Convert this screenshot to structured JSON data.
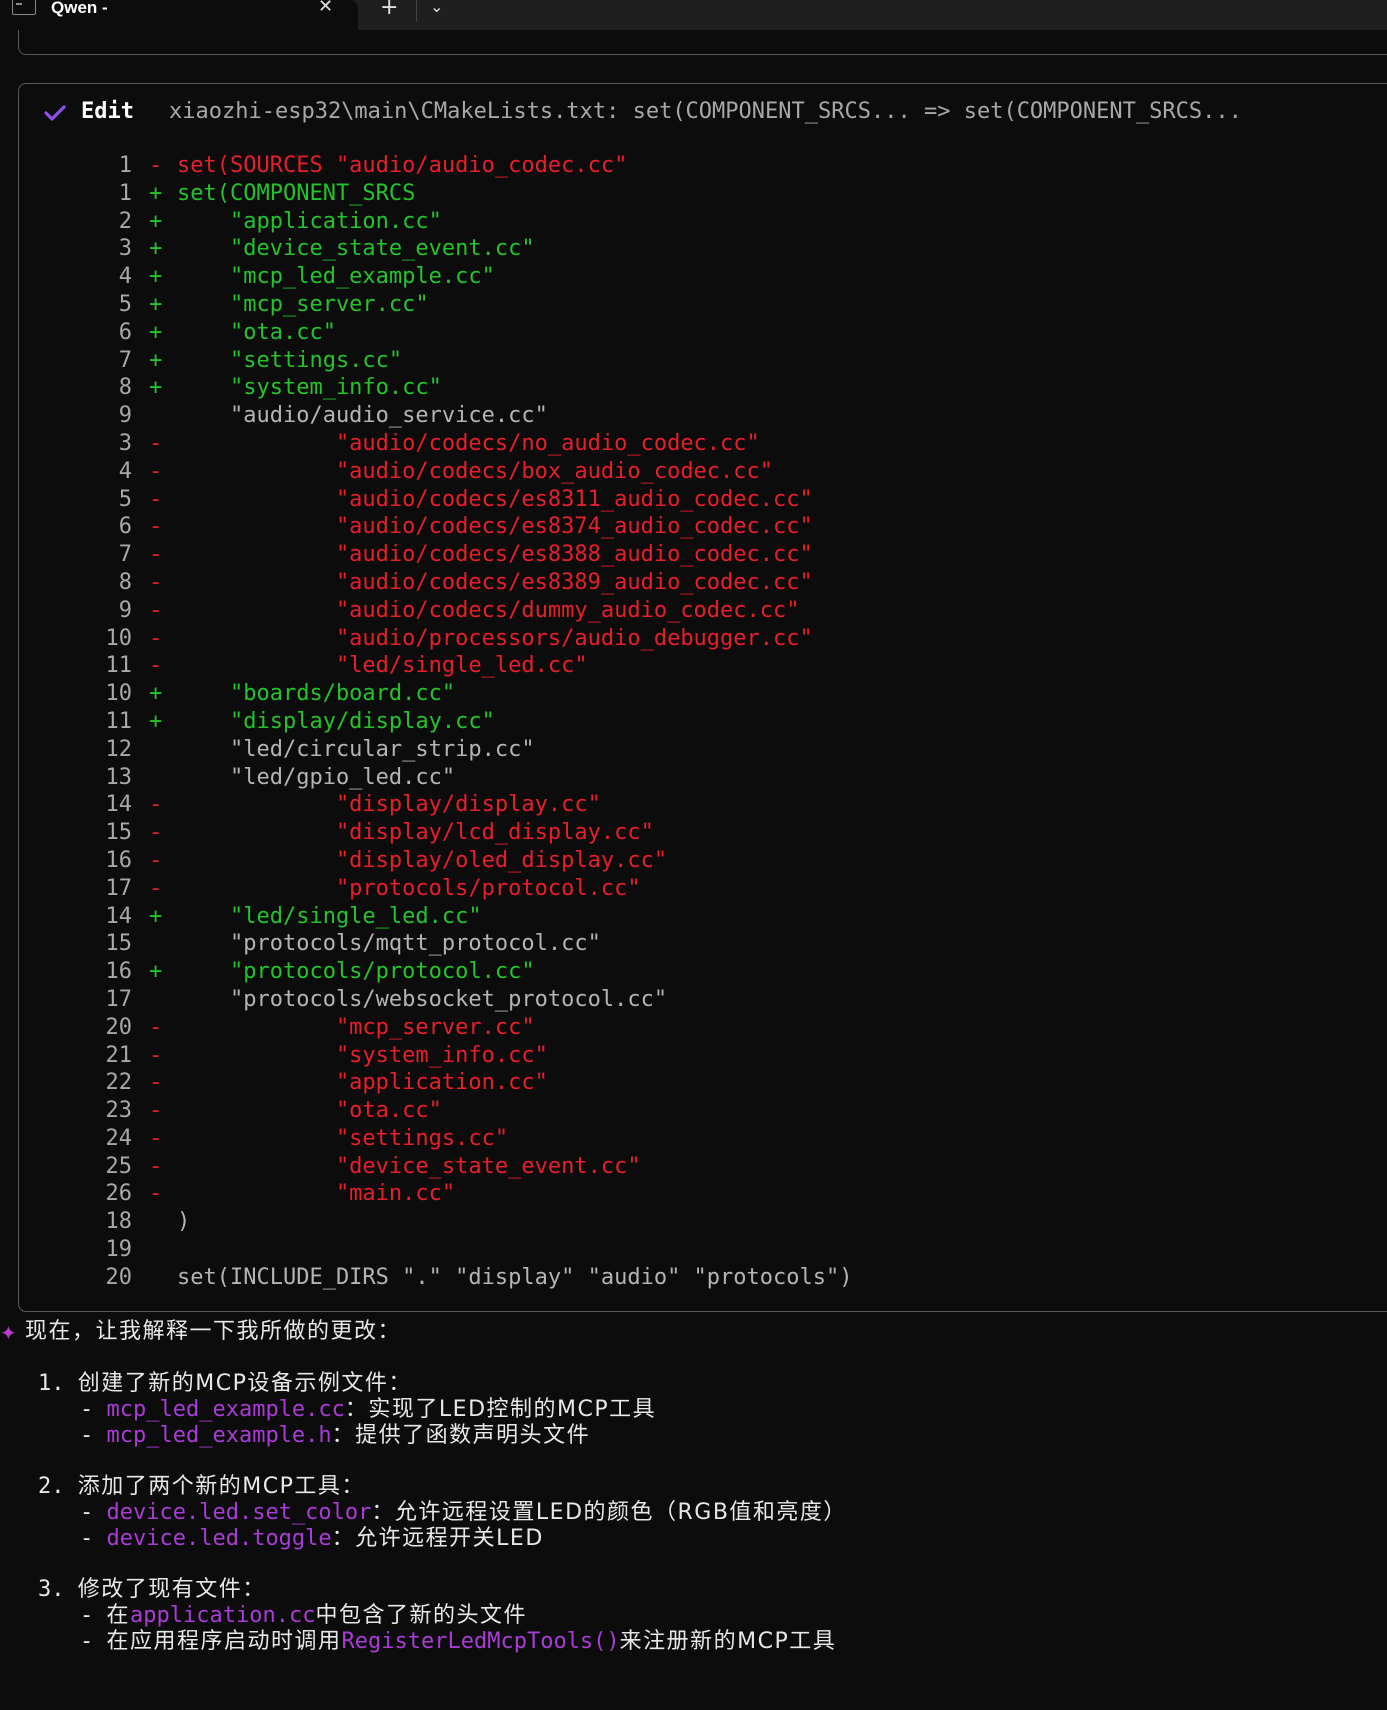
{
  "window": {
    "tab_title": "Qwen -",
    "close_glyph": "✕",
    "new_tab_glyph": "+",
    "dropdown_glyph": "⌄"
  },
  "colors": {
    "deleted": "#e81e2a",
    "added": "#23c42b",
    "context": "#b4b4b4",
    "code_ref": "#a93bd6",
    "check": "#8a52e8"
  },
  "edit": {
    "icon": "check-icon",
    "label": "Edit",
    "description": "xiaozhi-esp32\\main\\CMakeLists.txt: set(COMPONENT_SRCS... => set(COMPONENT_SRCS...",
    "diff_lines": [
      {
        "num": "1",
        "type": "del",
        "marker": "-",
        "code": "set(SOURCES \"audio/audio_codec.cc\""
      },
      {
        "num": "1",
        "type": "add",
        "marker": "+",
        "code": "set(COMPONENT_SRCS"
      },
      {
        "num": "2",
        "type": "add",
        "marker": "+",
        "code": "    \"application.cc\""
      },
      {
        "num": "3",
        "type": "add",
        "marker": "+",
        "code": "    \"device_state_event.cc\""
      },
      {
        "num": "4",
        "type": "add",
        "marker": "+",
        "code": "    \"mcp_led_example.cc\""
      },
      {
        "num": "5",
        "type": "add",
        "marker": "+",
        "code": "    \"mcp_server.cc\""
      },
      {
        "num": "6",
        "type": "add",
        "marker": "+",
        "code": "    \"ota.cc\""
      },
      {
        "num": "7",
        "type": "add",
        "marker": "+",
        "code": "    \"settings.cc\""
      },
      {
        "num": "8",
        "type": "add",
        "marker": "+",
        "code": "    \"system_info.cc\""
      },
      {
        "num": "9",
        "type": "ctx",
        "marker": "",
        "code": "    \"audio/audio_service.cc\""
      },
      {
        "num": "3",
        "type": "del",
        "marker": "-",
        "code": "            \"audio/codecs/no_audio_codec.cc\""
      },
      {
        "num": "4",
        "type": "del",
        "marker": "-",
        "code": "            \"audio/codecs/box_audio_codec.cc\""
      },
      {
        "num": "5",
        "type": "del",
        "marker": "-",
        "code": "            \"audio/codecs/es8311_audio_codec.cc\""
      },
      {
        "num": "6",
        "type": "del",
        "marker": "-",
        "code": "            \"audio/codecs/es8374_audio_codec.cc\""
      },
      {
        "num": "7",
        "type": "del",
        "marker": "-",
        "code": "            \"audio/codecs/es8388_audio_codec.cc\""
      },
      {
        "num": "8",
        "type": "del",
        "marker": "-",
        "code": "            \"audio/codecs/es8389_audio_codec.cc\""
      },
      {
        "num": "9",
        "type": "del",
        "marker": "-",
        "code": "            \"audio/codecs/dummy_audio_codec.cc\""
      },
      {
        "num": "10",
        "type": "del",
        "marker": "-",
        "code": "            \"audio/processors/audio_debugger.cc\""
      },
      {
        "num": "11",
        "type": "del",
        "marker": "-",
        "code": "            \"led/single_led.cc\""
      },
      {
        "num": "10",
        "type": "add",
        "marker": "+",
        "code": "    \"boards/board.cc\""
      },
      {
        "num": "11",
        "type": "add",
        "marker": "+",
        "code": "    \"display/display.cc\""
      },
      {
        "num": "12",
        "type": "ctx",
        "marker": "",
        "code": "    \"led/circular_strip.cc\""
      },
      {
        "num": "13",
        "type": "ctx",
        "marker": "",
        "code": "    \"led/gpio_led.cc\""
      },
      {
        "num": "14",
        "type": "del",
        "marker": "-",
        "code": "            \"display/display.cc\""
      },
      {
        "num": "15",
        "type": "del",
        "marker": "-",
        "code": "            \"display/lcd_display.cc\""
      },
      {
        "num": "16",
        "type": "del",
        "marker": "-",
        "code": "            \"display/oled_display.cc\""
      },
      {
        "num": "17",
        "type": "del",
        "marker": "-",
        "code": "            \"protocols/protocol.cc\""
      },
      {
        "num": "14",
        "type": "add",
        "marker": "+",
        "code": "    \"led/single_led.cc\""
      },
      {
        "num": "15",
        "type": "ctx",
        "marker": "",
        "code": "    \"protocols/mqtt_protocol.cc\""
      },
      {
        "num": "16",
        "type": "add",
        "marker": "+",
        "code": "    \"protocols/protocol.cc\""
      },
      {
        "num": "17",
        "type": "ctx",
        "marker": "",
        "code": "    \"protocols/websocket_protocol.cc\""
      },
      {
        "num": "20",
        "type": "del",
        "marker": "-",
        "code": "            \"mcp_server.cc\""
      },
      {
        "num": "21",
        "type": "del",
        "marker": "-",
        "code": "            \"system_info.cc\""
      },
      {
        "num": "22",
        "type": "del",
        "marker": "-",
        "code": "            \"application.cc\""
      },
      {
        "num": "23",
        "type": "del",
        "marker": "-",
        "code": "            \"ota.cc\""
      },
      {
        "num": "24",
        "type": "del",
        "marker": "-",
        "code": "            \"settings.cc\""
      },
      {
        "num": "25",
        "type": "del",
        "marker": "-",
        "code": "            \"device_state_event.cc\""
      },
      {
        "num": "26",
        "type": "del",
        "marker": "-",
        "code": "            \"main.cc\""
      },
      {
        "num": "18",
        "type": "ctx",
        "marker": "",
        "code": ")"
      },
      {
        "num": "19",
        "type": "ctx",
        "marker": "",
        "code": ""
      },
      {
        "num": "20",
        "type": "ctx",
        "marker": "",
        "code": "set(INCLUDE_DIRS \".\" \"display\" \"audio\" \"protocols\")"
      }
    ]
  },
  "explanation": {
    "icon": "sparkle-icon",
    "intro": "现在，让我解释一下我所做的更改：",
    "sections": [
      {
        "number": "1.",
        "title": "创建了新的MCP设备示例文件：",
        "items": [
          {
            "parts": [
              {
                "text": "mcp_led_example.cc",
                "code": true
              },
              {
                "text": "：实现了LED控制的MCP工具",
                "code": false
              }
            ]
          },
          {
            "parts": [
              {
                "text": "mcp_led_example.h",
                "code": true
              },
              {
                "text": "：提供了函数声明头文件",
                "code": false
              }
            ]
          }
        ]
      },
      {
        "number": "2.",
        "title": "添加了两个新的MCP工具：",
        "items": [
          {
            "parts": [
              {
                "text": "device.led.set_color",
                "code": true
              },
              {
                "text": "：允许远程设置LED的颜色（RGB值和亮度）",
                "code": false
              }
            ]
          },
          {
            "parts": [
              {
                "text": "device.led.toggle",
                "code": true
              },
              {
                "text": "：允许远程开关LED",
                "code": false
              }
            ]
          }
        ]
      },
      {
        "number": "3.",
        "title": "修改了现有文件：",
        "items": [
          {
            "parts": [
              {
                "text": "在",
                "code": false
              },
              {
                "text": "application.cc",
                "code": true
              },
              {
                "text": "中包含了新的头文件",
                "code": false
              }
            ]
          },
          {
            "parts": [
              {
                "text": "在应用程序启动时调用",
                "code": false
              },
              {
                "text": "RegisterLedMcpTools()",
                "code": true
              },
              {
                "text": "来注册新的MCP工具",
                "code": false
              }
            ]
          }
        ]
      }
    ]
  }
}
